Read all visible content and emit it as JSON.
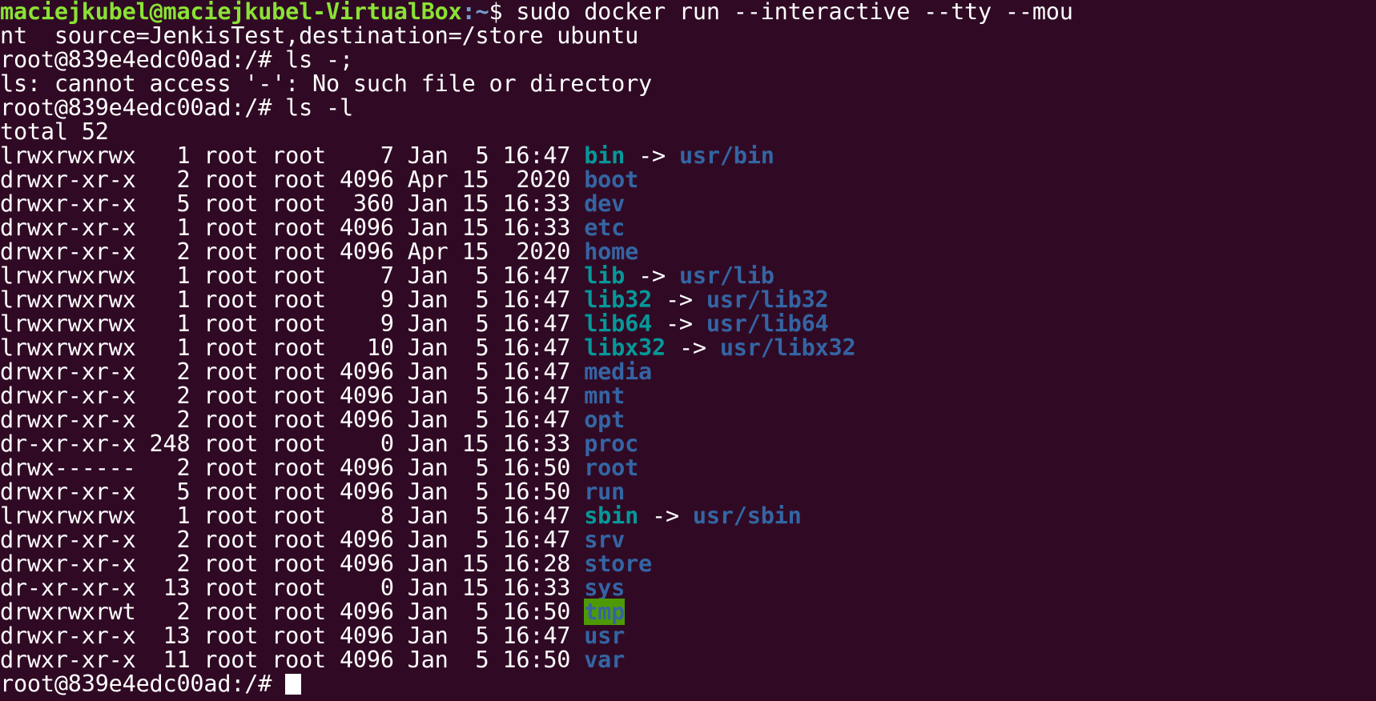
{
  "command": {
    "user_host": "maciejkubel@maciejkubel-VirtualBox",
    "path": ":~",
    "text": "$ sudo docker run --interactive --tty --mou",
    "wrap": "nt  source=JenkisTest,destination=/store ubuntu"
  },
  "prompt": "root@839e4edc00ad:/# ",
  "cmd1": "ls -;",
  "error": "ls: cannot access '-': No such file or directory",
  "cmd2": "ls -l",
  "total": "total 52",
  "rows": [
    {
      "meta": "lrwxrwxrwx   1 root root    7 Jan  5 16:47 ",
      "name": "bin",
      "kind": "link",
      "target": "usr/bin"
    },
    {
      "meta": "drwxr-xr-x   2 root root 4096 Apr 15  2020 ",
      "name": "boot",
      "kind": "dir"
    },
    {
      "meta": "drwxr-xr-x   5 root root  360 Jan 15 16:33 ",
      "name": "dev",
      "kind": "dir"
    },
    {
      "meta": "drwxr-xr-x   1 root root 4096 Jan 15 16:33 ",
      "name": "etc",
      "kind": "dir"
    },
    {
      "meta": "drwxr-xr-x   2 root root 4096 Apr 15  2020 ",
      "name": "home",
      "kind": "dir"
    },
    {
      "meta": "lrwxrwxrwx   1 root root    7 Jan  5 16:47 ",
      "name": "lib",
      "kind": "link",
      "target": "usr/lib"
    },
    {
      "meta": "lrwxrwxrwx   1 root root    9 Jan  5 16:47 ",
      "name": "lib32",
      "kind": "link",
      "target": "usr/lib32"
    },
    {
      "meta": "lrwxrwxrwx   1 root root    9 Jan  5 16:47 ",
      "name": "lib64",
      "kind": "link",
      "target": "usr/lib64"
    },
    {
      "meta": "lrwxrwxrwx   1 root root   10 Jan  5 16:47 ",
      "name": "libx32",
      "kind": "link",
      "target": "usr/libx32"
    },
    {
      "meta": "drwxr-xr-x   2 root root 4096 Jan  5 16:47 ",
      "name": "media",
      "kind": "dir"
    },
    {
      "meta": "drwxr-xr-x   2 root root 4096 Jan  5 16:47 ",
      "name": "mnt",
      "kind": "dir"
    },
    {
      "meta": "drwxr-xr-x   2 root root 4096 Jan  5 16:47 ",
      "name": "opt",
      "kind": "dir"
    },
    {
      "meta": "dr-xr-xr-x 248 root root    0 Jan 15 16:33 ",
      "name": "proc",
      "kind": "dir"
    },
    {
      "meta": "drwx------   2 root root 4096 Jan  5 16:50 ",
      "name": "root",
      "kind": "dir"
    },
    {
      "meta": "drwxr-xr-x   5 root root 4096 Jan  5 16:50 ",
      "name": "run",
      "kind": "dir"
    },
    {
      "meta": "lrwxrwxrwx   1 root root    8 Jan  5 16:47 ",
      "name": "sbin",
      "kind": "link",
      "target": "usr/sbin"
    },
    {
      "meta": "drwxr-xr-x   2 root root 4096 Jan  5 16:47 ",
      "name": "srv",
      "kind": "dir"
    },
    {
      "meta": "drwxr-xr-x   2 root root 4096 Jan 15 16:28 ",
      "name": "store",
      "kind": "dir"
    },
    {
      "meta": "dr-xr-xr-x  13 root root    0 Jan 15 16:33 ",
      "name": "sys",
      "kind": "dir"
    },
    {
      "meta": "drwxrwxrwt   2 root root 4096 Jan  5 16:50 ",
      "name": "tmp",
      "kind": "sticky"
    },
    {
      "meta": "drwxr-xr-x  13 root root 4096 Jan  5 16:47 ",
      "name": "usr",
      "kind": "dir"
    },
    {
      "meta": "drwxr-xr-x  11 root root 4096 Jan  5 16:50 ",
      "name": "var",
      "kind": "dir"
    }
  ],
  "colors": {
    "background": "#300a24",
    "text": "#ffffff",
    "prompt_user": "#8ae234",
    "directory": "#3465a4",
    "symlink": "#06989a",
    "sticky_bg": "#4e9a06"
  }
}
